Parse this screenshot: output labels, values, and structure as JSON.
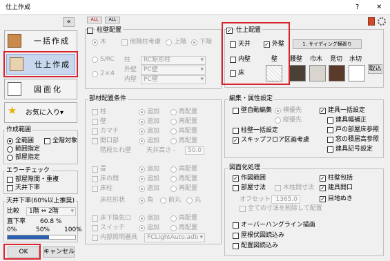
{
  "window": {
    "title": "仕上作成",
    "help": "?",
    "close": "✕"
  },
  "left": {
    "collapse": "«",
    "btn_ikkatsu": "一括作成",
    "btn_shiage": "仕上作成",
    "btn_zumenka": "図面化",
    "btn_favorite": "お気に入り▾",
    "range": {
      "title": "作成範囲",
      "all": "全範囲",
      "all_target": "全階対象",
      "range_spec": "範囲指定",
      "room_spec": "部屋指定"
    },
    "error": {
      "title": "エラーチェック",
      "room_gap": "部屋隙間・重複",
      "ceiling": "天井下率"
    },
    "ratio": {
      "title": "天井下率(60%以上推奨)",
      "compare_label": "比較",
      "compare_value": "1階 ⇔ 2階",
      "direct_label": "直下率",
      "direct_value": "60.8 %",
      "scale_0": "0%",
      "scale_50": "50%",
      "scale_100": "100%",
      "fill": 0.608
    },
    "ok": "OK",
    "cancel": "キャンセル"
  },
  "mini": {
    "all": "ALL",
    "none": "ALL"
  },
  "kabe": {
    "title": "柱壁配置",
    "wood": "木",
    "other_col": "他階柱考慮",
    "upper": "上階",
    "lower": "下階",
    "src": "S/RC",
    "x24": "2×4",
    "pillar": "柱",
    "pillar_v": "RC矩形柱",
    "outer": "外壁",
    "outer_v": "PC壁",
    "inner": "内壁",
    "inner_v": "PC壁"
  },
  "shiage": {
    "title": "仕上配置",
    "ceiling": "天井",
    "outer": "外壁",
    "inner": "内壁",
    "floor": "床",
    "btn_name": "1. サイディング横張り",
    "lbl_wall": "壁",
    "lbl_koshi": "腰壁",
    "lbl_haba": "巾木",
    "lbl_mikiri": "見切",
    "lbl_mizukiri": "水切",
    "btn_toride": "取込"
  },
  "buzai": {
    "title": "部材配置条件",
    "items": [
      "柱",
      "壁",
      "カマチ",
      "開口部",
      "畳",
      "床の間",
      "床柱",
      "床下換気口",
      "スイッチ",
      "内部照明器具"
    ],
    "add": "追加",
    "replace": "再配置",
    "hanging": "階段たれ壁",
    "ceil_h": "天井高さ -",
    "ceil_v": "50.0",
    "pillar_shape": "床柱形状",
    "kaku": "角",
    "maru_half": "前丸",
    "maru": "丸",
    "light_v": "FCLightAuto.adb"
  },
  "edit": {
    "title": "編集・属性設定",
    "wall_auto": "壁自動編集",
    "horiz": "横優先",
    "vert": "縦優先",
    "col_bulk": "柱壁一括設定",
    "skip_flip": "スキップフロア区画考慮",
    "tategu_bulk": "建具一括設定",
    "tategu_width": "建具幅補正",
    "door_flip": "戸の部屋床参照",
    "window_flip": "窓の積居高参照",
    "tategu_no": "建具記号設定"
  },
  "zumen": {
    "title": "図面化処理",
    "create": "作図範囲",
    "room_dim": "部屋寸法",
    "wood_dim": "木柱間寸法",
    "offset": "オフセット",
    "offset_v": "1365.0",
    "delete_all": "全ての寸法を削除して配置",
    "overhang": "オーバーハングライン描画",
    "roof": "屋根伏図読込み",
    "layout": "配置図読込み",
    "col_mark": "柱壁包括",
    "tategu_open": "建具開口",
    "eye": "目地ぬき"
  },
  "colors": {
    "red": "#d9232e",
    "accent": "#2b5fb3"
  }
}
